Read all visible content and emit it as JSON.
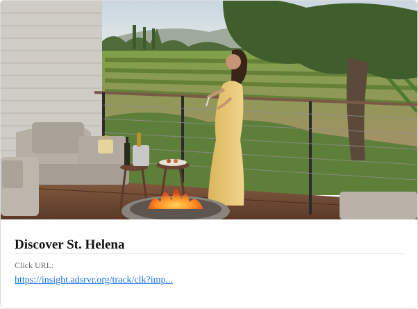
{
  "ad": {
    "title": "Discover St. Helena",
    "click_label": "Click URL:",
    "click_url": "https://insight.adsrvr.org/track/clk?imp..."
  },
  "colors": {
    "link": "#1a73e8",
    "title": "#111111",
    "label": "#666666"
  }
}
